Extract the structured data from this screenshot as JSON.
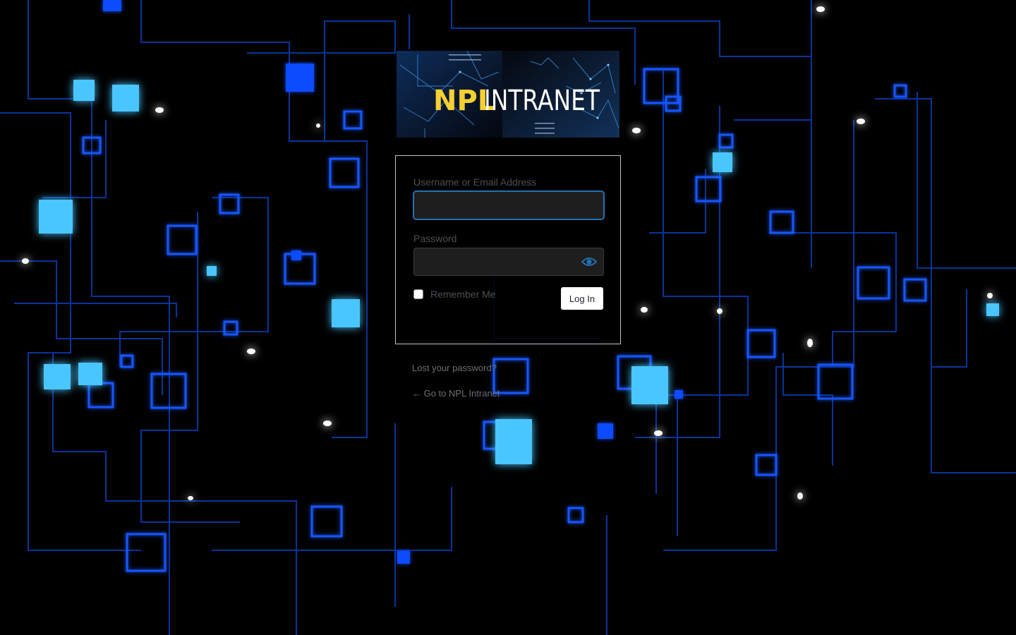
{
  "site": {
    "logo_text_primary": "NPL",
    "logo_text_secondary": "INTRANET",
    "brand_yellow": "#f5d033",
    "background_accent": "#1e6bff"
  },
  "login_form": {
    "username_label": "Username or Email Address",
    "username_value": "",
    "password_label": "Password",
    "password_value": "",
    "password_toggle_icon": "eye-icon",
    "remember_label": "Remember Me",
    "remember_checked": false,
    "submit_label": "Log In"
  },
  "footer_links": {
    "lost_password": "Lost your password?",
    "back_to_site": "← Go to NPL Intranet"
  }
}
